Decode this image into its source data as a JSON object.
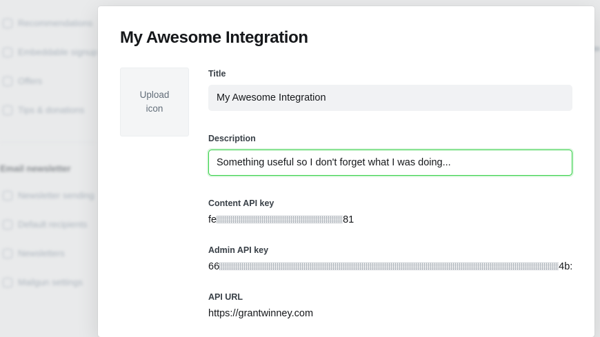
{
  "background": {
    "sidebar_items": [
      {
        "label": "Recommendations",
        "icon": "heart-icon"
      },
      {
        "label": "Embeddable signup form",
        "icon": "embed-icon"
      },
      {
        "label": "Offers",
        "icon": "percent-icon"
      },
      {
        "label": "Tips & donations",
        "icon": "donation-icon"
      }
    ],
    "section_heading": "Email newsletter",
    "newsletter_items": [
      {
        "label": "Newsletter sending",
        "icon": "send-icon"
      },
      {
        "label": "Default recipients",
        "icon": "users-icon"
      },
      {
        "label": "Newsletters",
        "icon": "mail-icon"
      },
      {
        "label": "Mailgun settings",
        "icon": "gear-icon"
      }
    ]
  },
  "modal": {
    "title": "My Awesome Integration",
    "upload": {
      "line1": "Upload",
      "line2": "icon"
    },
    "fields": {
      "title_label": "Title",
      "title_value": "My Awesome Integration",
      "description_label": "Description",
      "description_value": "Something useful so I don't forget what I was doing...",
      "content_key_label": "Content API key",
      "content_key_prefix": "fe",
      "content_key_suffix": "81",
      "admin_key_label": "Admin API key",
      "admin_key_prefix": "66",
      "admin_key_suffix": "4b:",
      "api_url_label": "API URL",
      "api_url_value": "https://grantwinney.com"
    }
  },
  "colors": {
    "focus_border": "#30cf43",
    "input_bg": "#f1f2f4",
    "text": "#15171a",
    "muted": "#626d79"
  }
}
